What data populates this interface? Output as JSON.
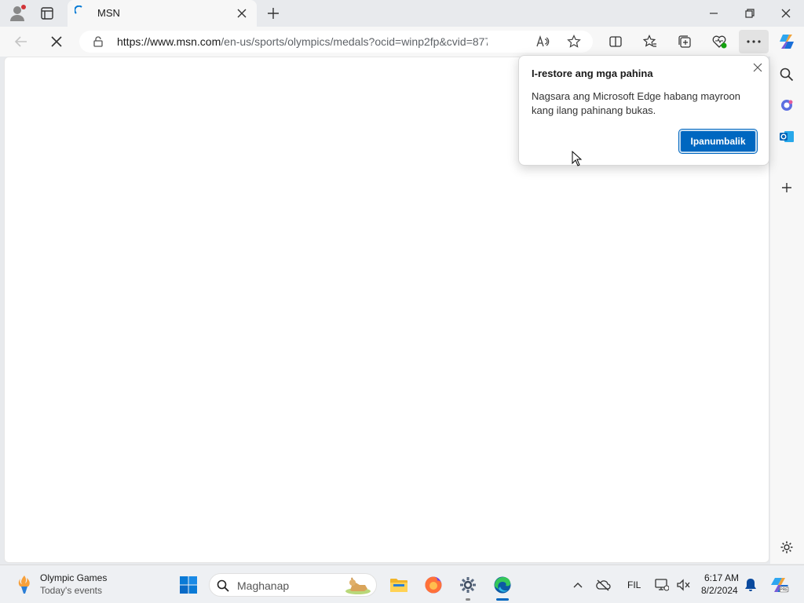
{
  "browser": {
    "tab": {
      "title": "MSN"
    },
    "address": {
      "url_host": "https://www.msn.com",
      "url_path": "/en-us/sports/olympics/medals?ocid=winp2fp&cvid=877bb..."
    }
  },
  "popup": {
    "title": "I-restore ang mga pahina",
    "message": "Nagsara ang Microsoft Edge habang mayroon kang ilang pahinang bukas.",
    "button_label": "Ipanumbalik"
  },
  "taskbar": {
    "widget_title": "Olympic Games",
    "widget_subtitle": "Today's events",
    "search_placeholder": "Maghanap",
    "language": "FIL",
    "time": "6:17 AM",
    "date": "8/2/2024"
  },
  "colors": {
    "accent": "#0067c0",
    "chrome": "#f7f7f7",
    "tabbar": "#e8eaed"
  }
}
